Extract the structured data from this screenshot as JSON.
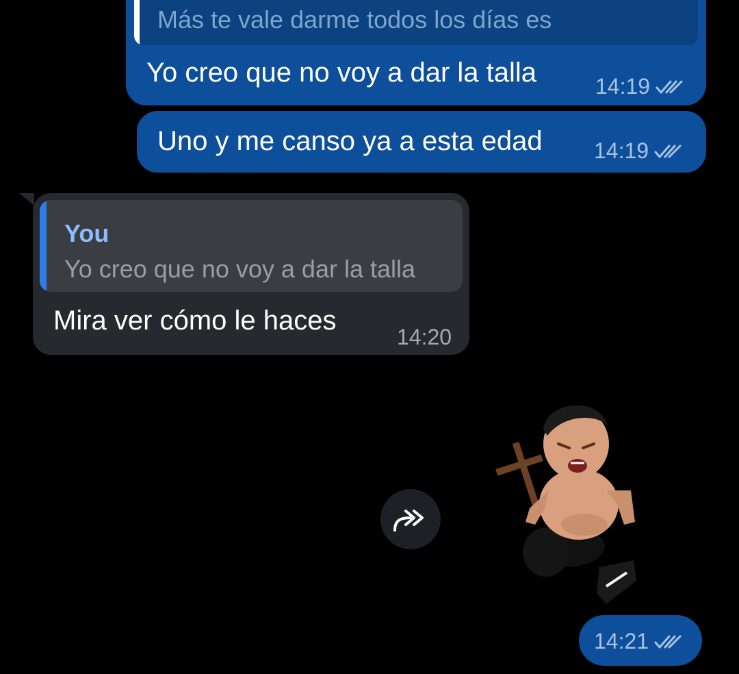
{
  "messages": [
    {
      "direction": "outgoing",
      "quote_text": "Más te vale darme todos los días es",
      "text": "Yo creo que no voy a dar la talla",
      "time": "14:19",
      "status": "read-double-check"
    },
    {
      "direction": "outgoing",
      "text": "Uno y me canso ya a esta edad",
      "time": "14:19",
      "status": "read-double-check"
    },
    {
      "direction": "incoming",
      "quote_sender": "You",
      "quote_text": "Yo creo que no voy a dar la talla",
      "text": "Mira ver cómo le haces",
      "time": "14:20"
    },
    {
      "direction": "outgoing",
      "type": "sticker",
      "sticker": "crying-boy-with-cross-sticker",
      "time": "14:21",
      "status": "read-double-check"
    }
  ],
  "icons": {
    "forward": "forward-arrows-icon",
    "read": "double-check-icon"
  },
  "colors": {
    "background": "#000000",
    "outgoing_bubble": "#0d4f9a",
    "incoming_bubble": "#26292d",
    "quote_accent": "#2f7be8",
    "quote_sender": "#8ebcff"
  }
}
